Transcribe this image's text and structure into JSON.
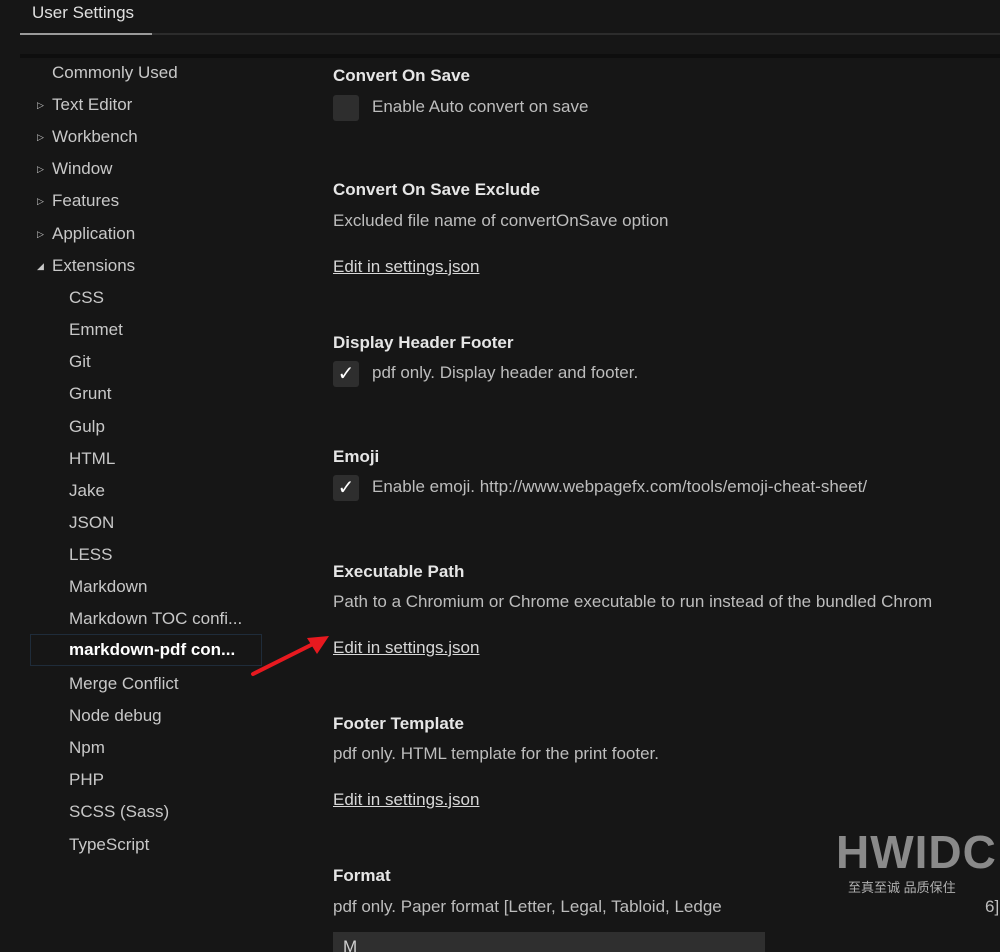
{
  "tab": {
    "label": "User Settings"
  },
  "sidebar": {
    "top_items": [
      {
        "label": "Commonly Used",
        "caret": ""
      },
      {
        "label": "Text Editor",
        "caret": "collapsed"
      },
      {
        "label": "Workbench",
        "caret": "collapsed"
      },
      {
        "label": "Window",
        "caret": "collapsed"
      },
      {
        "label": "Features",
        "caret": "collapsed"
      },
      {
        "label": "Application",
        "caret": "collapsed"
      },
      {
        "label": "Extensions",
        "caret": "expanded"
      }
    ],
    "extensions": [
      "CSS",
      "Emmet",
      "Git",
      "Grunt",
      "Gulp",
      "HTML",
      "Jake",
      "JSON",
      "LESS",
      "Markdown",
      "Markdown TOC confi...",
      "markdown-pdf con...",
      "Merge Conflict",
      "Node debug",
      "Npm",
      "PHP",
      "SCSS (Sass)",
      "TypeScript"
    ],
    "selected": "markdown-pdf con..."
  },
  "settings": {
    "convert_on_save": {
      "title": "Convert On Save",
      "desc": "Enable Auto convert on save",
      "checked": false
    },
    "convert_on_save_exclude": {
      "title": "Convert On Save Exclude",
      "desc": "Excluded file name of convertOnSave option",
      "link": "Edit in settings.json"
    },
    "display_header_footer": {
      "title": "Display Header Footer",
      "desc": "pdf only. Display header and footer.",
      "checked": true
    },
    "emoji": {
      "title": "Emoji",
      "desc": "Enable emoji. http://www.webpagefx.com/tools/emoji-cheat-sheet/",
      "checked": true
    },
    "executable_path": {
      "title": "Executable Path",
      "desc": "Path to a Chromium or Chrome executable to run instead of the bundled Chrom",
      "link": "Edit in settings.json"
    },
    "footer_template": {
      "title": "Footer Template",
      "desc": "pdf only. HTML template for the print footer.",
      "link": "Edit in settings.json"
    },
    "format": {
      "title": "Format",
      "desc": "pdf only. Paper format [Letter, Legal, Tabloid, Ledge",
      "desc_tail": "6]",
      "select_value": "M"
    }
  },
  "checkmark_glyph": "✓",
  "watermark": {
    "logo": "HWIDC",
    "tagline": "至真至诚 品质保住"
  },
  "colors": {
    "background": "#161616",
    "annotation_arrow": "#e8191f",
    "selected_border": "#1f2c3a"
  }
}
